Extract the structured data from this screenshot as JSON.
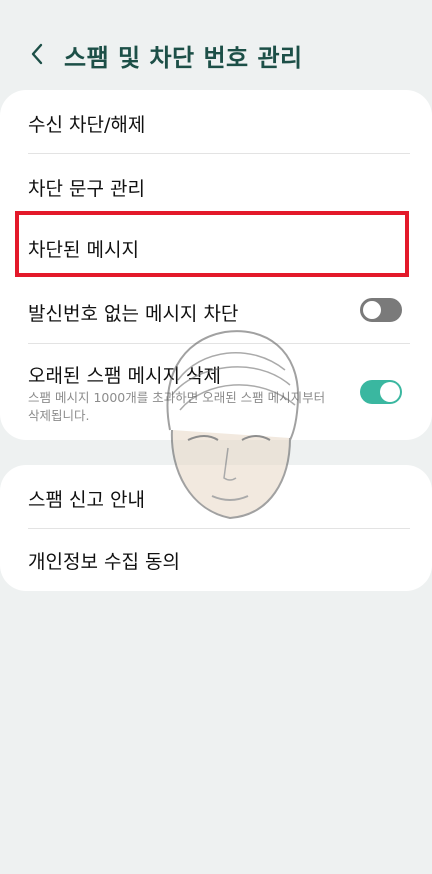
{
  "header": {
    "back_icon": "chevron-left-icon",
    "title": "스팸 및 차단 번호 관리"
  },
  "card1": {
    "items": [
      {
        "label": "수신 차단/해제"
      },
      {
        "label": "차단 문구 관리"
      },
      {
        "label": "차단된 메시지"
      },
      {
        "label": "발신번호 없는 메시지 차단",
        "toggle": false
      },
      {
        "label": "오래된 스팸 메시지 삭제",
        "sub": "스팸 메시지 1000개를 초과하면 오래된 스팸 메시지부터 삭제됩니다.",
        "toggle": true
      }
    ]
  },
  "card2": {
    "items": [
      {
        "label": "스팸 신고 안내"
      },
      {
        "label": "개인정보 수집 동의"
      }
    ]
  },
  "colors": {
    "background": "#eef1f1",
    "title": "#1c4f47",
    "accent_toggle_on": "#3ab7a0",
    "highlight": "#e3192a"
  }
}
